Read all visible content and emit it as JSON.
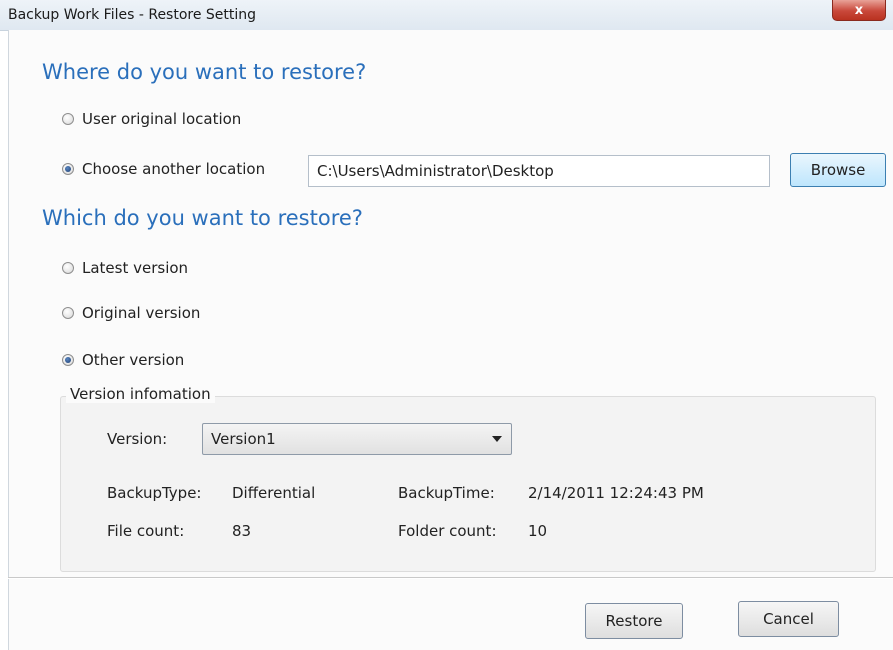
{
  "window": {
    "title": "Backup Work Files - Restore Setting",
    "close_label": "x"
  },
  "restore_location": {
    "heading": "Where do you want to restore?",
    "options": [
      {
        "label": "User original location",
        "checked": false
      },
      {
        "label": "Choose another location",
        "checked": true
      }
    ],
    "path_value": "C:\\Users\\Administrator\\Desktop",
    "browse_label": "Browse"
  },
  "restore_version": {
    "heading": "Which do you want to restore?",
    "options": [
      {
        "label": "Latest version",
        "checked": false
      },
      {
        "label": "Original version",
        "checked": false
      },
      {
        "label": "Other version",
        "checked": true
      }
    ]
  },
  "version_info": {
    "group_label": "Version infomation",
    "version_label": "Version:",
    "version_selected": "Version1",
    "backup_type_label": "BackupType:",
    "backup_type_value": "Differential",
    "backup_time_label": "BackupTime:",
    "backup_time_value": "2/14/2011 12:24:43 PM",
    "file_count_label": "File count:",
    "file_count_value": "83",
    "folder_count_label": "Folder count:",
    "folder_count_value": "10"
  },
  "footer": {
    "restore_label": "Restore",
    "cancel_label": "Cancel"
  },
  "colors": {
    "heading": "#2a6fbb",
    "close_button": "#c9483a",
    "browse_button_border": "#3c7fb1"
  }
}
